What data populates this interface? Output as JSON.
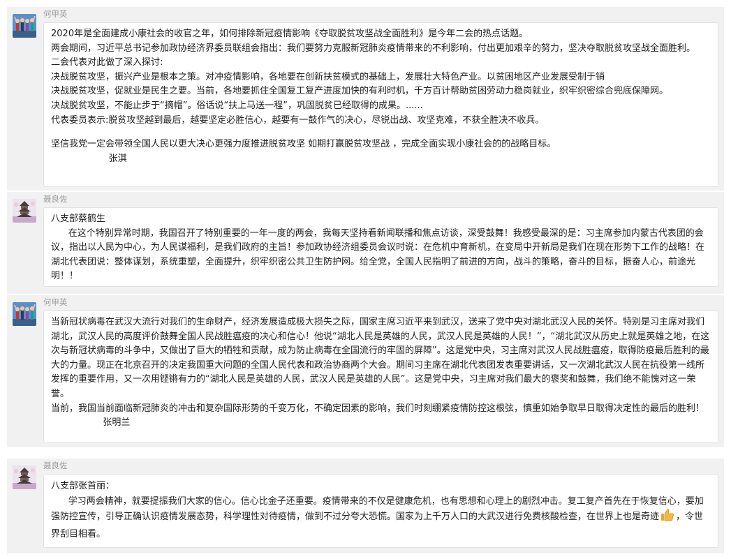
{
  "messages": [
    {
      "sender": "何甲英",
      "avatar": "people-photo-icon",
      "lines": [
        "2020年是全面建成小康社会的收官之年，如何排除新冠疫情影响《夺取脱贫攻坚战全面胜利》是今年二会的热点话题。",
        "两会期间，习近平总书记参加政协经济界委员联组会指出：我们要努力克服新冠肺炎疫情带来的不利影响，付出更加艰辛的努力，坚决夺取脱贫攻坚战全面胜利。",
        "二会代表对此做了深入探讨:",
        "决战脱贫攻坚，振兴产业是根本之策。对冲疫情影响，各地要在创新扶贫模式的基础上，发展壮大特色产业。以贫困地区产业发展受制于销",
        "决战脱贫攻坚，促就业是民生之要。当前，各地要抓住全国复工复产进度加快的有利时机，千方百计帮助贫困劳动力稳岗就业，织牢织密综合兜底保障网。",
        "决战脱贫攻坚，不能止步于“摘帽”。俗话说“扶上马送一程”，巩固脱贫已经取得的成果。......",
        "代表委员表示:脱贫攻坚越到最后，越要坚定必胜信心，越要有一鼓作气的决心，尽锐出战、攻坚克难，不获全胜决不收兵。",
        "",
        "坚信我党一定会带领全国人民以更大决心更强力度推进脱贫攻坚 如期打赢脱贫攻坚战 ，完成全面实现小康社会的的战略目标。",
        "                    张淇"
      ]
    },
    {
      "sender": "聂良佐",
      "avatar": "pagoda-photo-icon",
      "lines": [
        "八支部蔡鹤生",
        "      在这个特别异常时期，我国召开了特别重要的一年一度的两会，我每天坚持看新闻联播和焦点访谈，深受鼓舞！我感受最深的是：习主席参加内蒙古代表团的会议，指出以人民为中心，为人民谋福利，是我们政府的主旨！参加政协经济组委员会议时说：在危机中育新机，在变局中开新局是我们在现在形势下工作的战略！在湖北代表团说：整体谋划，系统重塑，全面提升，织牢织密公共卫生防护网。给全党，全国人民指明了前进的方向，战斗的策略，奋斗的目标，振奋人心，前途光明！！"
      ]
    },
    {
      "sender": "何甲英",
      "avatar": "people-photo-icon",
      "lines": [
        "当新冠状病毒在武汉大流行对我们的生命财产，经济发展造成极大损失之际，国家主席习近平来到武汉，送来了党中央对湖北武汉人民的关怀。特别是习主席对我们湖北，武汉人民的高度评价鼓舞全国人民战胜瘟疫的决心和信心！他说“湖北人民是英雄的人民，武汉人民是英雄的人民！”，“湖北武汉从历史上就是英雄之地，在这次与新冠状病毒的斗争中，又做出了巨大的牺牲和贡献，成为防止病毒在全国流行的牢固的屏障”。这是党中央，习主席对武汉人民战胜瘟疫，取得防疫最后胜利的最大的力量。现正在北京召开的决定我国重大问题的全国人民代表和政治协商两个大会。期间习主席在湖北代表团发表重要讲话，又一次湖北武汉人民在抗役第一线所发挥的重要作用，又一次用铿锵有力的“湖北人民是英雄的人民，武汉人民是英雄的人民”。这是党中央，习主席对我们最大的褒奖和鼓舞，我们绝不能愧对这一荣誉。",
        "当前，我国当前面临新冠肺炎的冲击和复杂国际形势的千变万化，不确定因素的影响，我们时刻绷紧疫情防控这根弦，慎重如始争取早日取得决定性的最后的胜利！",
        "                  张明兰"
      ]
    },
    {
      "sender": "聂良佐",
      "avatar": "pagoda-photo-icon",
      "lines": [
        "八支部张首丽：",
        "      学习两会精神，就要提振我们大家的信心。信心比金子还重要。疫情带来的不仅是健康危机，也有思想和心理上的剧烈冲击。复工复产首先在于恢复信心，要加强防控宣传，引导正确认识疫情发展态势，科学理性对待疫情，做到不过分夸大恐慌。国家为上千万人口的大武汉进行免费核酸检查，在世界上也是奇迹"
      ],
      "tail": "，令世界刮目相看。"
    }
  ]
}
